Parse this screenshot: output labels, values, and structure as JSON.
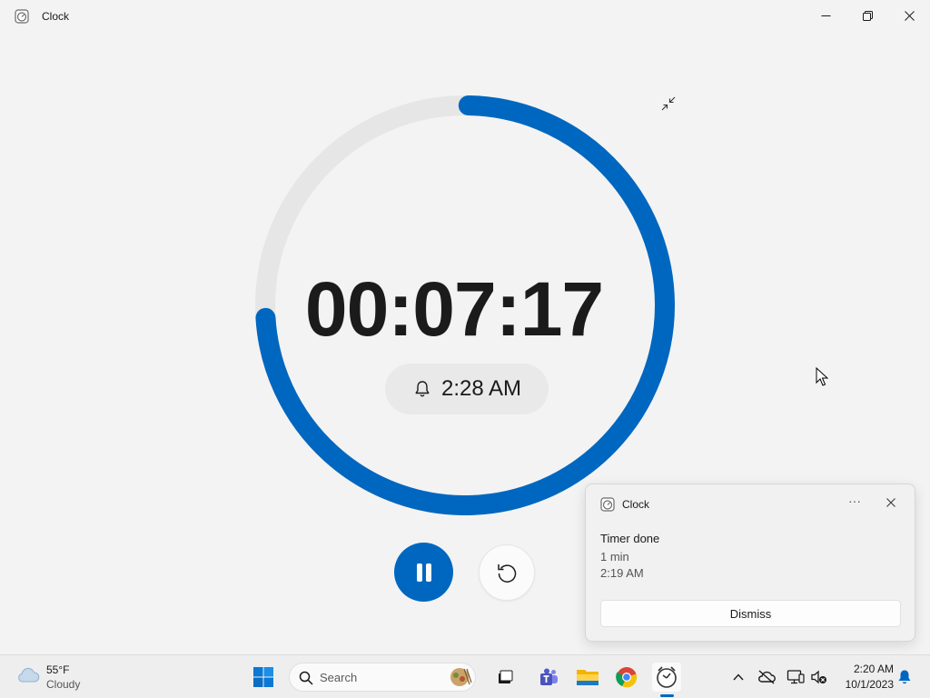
{
  "window": {
    "title": "Clock",
    "accent": "#0067c0"
  },
  "timer": {
    "display": "00:07:17",
    "alarm_time": "2:28 AM",
    "progress_fraction": 0.74,
    "progress_start_deg": 268,
    "progress_end_deg": 0
  },
  "controls": {
    "pause_icon": "pause-icon",
    "reset_icon": "reset-icon"
  },
  "notification": {
    "app_name": "Clock",
    "more": "···",
    "title": "Timer done",
    "duration": "1 min",
    "time": "2:19 AM",
    "dismiss_label": "Dismiss"
  },
  "taskbar": {
    "weather_temp": "55°F",
    "weather_desc": "Cloudy",
    "search_placeholder": "Search",
    "clock_time": "2:20 AM",
    "clock_date": "10/1/2023"
  }
}
